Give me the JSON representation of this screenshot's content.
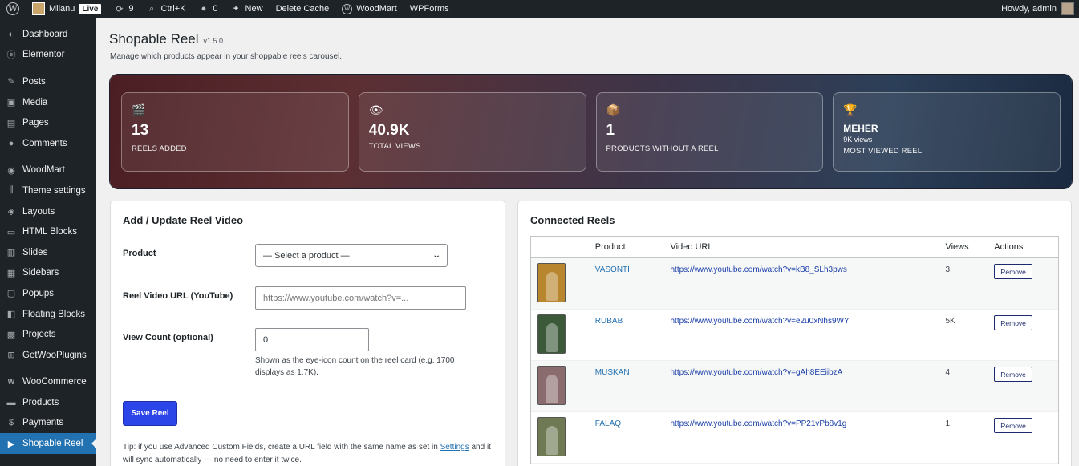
{
  "adminbar": {
    "site_name": "Milanu",
    "live_badge": "Live",
    "updates_count": "9",
    "shortcut": "Ctrl+K",
    "comments_count": "0",
    "new_label": "New",
    "delete_cache": "Delete Cache",
    "woodmart": "WoodMart",
    "wpforms": "WPForms",
    "howdy": "Howdy, admin"
  },
  "sidebar": {
    "items": [
      {
        "label": "Dashboard",
        "icon": "dashboard-icon"
      },
      {
        "label": "Elementor",
        "icon": "elementor-icon"
      },
      {
        "label": "Posts",
        "icon": "pin-icon"
      },
      {
        "label": "Media",
        "icon": "media-icon"
      },
      {
        "label": "Pages",
        "icon": "pages-icon"
      },
      {
        "label": "Comments",
        "icon": "comment-icon"
      },
      {
        "label": "WoodMart",
        "icon": "woodmart-icon"
      },
      {
        "label": "Theme settings",
        "icon": "sliders-icon"
      },
      {
        "label": "Layouts",
        "icon": "layers-icon"
      },
      {
        "label": "HTML Blocks",
        "icon": "html-icon"
      },
      {
        "label": "Slides",
        "icon": "slides-icon"
      },
      {
        "label": "Sidebars",
        "icon": "sidebar-icon"
      },
      {
        "label": "Popups",
        "icon": "popup-icon"
      },
      {
        "label": "Floating Blocks",
        "icon": "floating-icon"
      },
      {
        "label": "Projects",
        "icon": "projects-icon"
      },
      {
        "label": "GetWooPlugins",
        "icon": "plugin-icon"
      },
      {
        "label": "WooCommerce",
        "icon": "woo-icon"
      },
      {
        "label": "Products",
        "icon": "products-icon"
      },
      {
        "label": "Payments",
        "icon": "payments-icon"
      },
      {
        "label": "Shopable Reel",
        "icon": "play-icon"
      }
    ]
  },
  "page": {
    "title": "Shopable Reel",
    "version": "v1.5.0",
    "description": "Manage which products appear in your shoppable reels carousel."
  },
  "stats": [
    {
      "icon": "clapper-icon",
      "value": "13",
      "label": "REELS ADDED"
    },
    {
      "icon": "eye-icon",
      "value": "40.9K",
      "label": "TOTAL VIEWS"
    },
    {
      "icon": "box-icon",
      "value": "1",
      "label": "PRODUCTS WITHOUT A REEL"
    },
    {
      "icon": "trophy-icon",
      "value": "MEHER",
      "sub": "9K views",
      "label": "MOST VIEWED REEL"
    }
  ],
  "form": {
    "title": "Add / Update Reel Video",
    "product_label": "Product",
    "product_selected": "— Select a product —",
    "url_label": "Reel Video URL (YouTube)",
    "url_placeholder": "https://www.youtube.com/watch?v=...",
    "views_label": "View Count (optional)",
    "views_value": "0",
    "views_hint": "Shown as the eye-icon count on the reel card (e.g. 1700 displays as 1.7K).",
    "save_label": "Save Reel",
    "tip_before": "Tip: if you use Advanced Custom Fields, create a URL field with the same name as set in ",
    "tip_link": "Settings",
    "tip_after": " and it will sync automatically — no need to enter it twice."
  },
  "reels": {
    "title": "Connected Reels",
    "columns": {
      "product": "Product",
      "url": "Video URL",
      "views": "Views",
      "actions": "Actions"
    },
    "remove_label": "Remove",
    "rows": [
      {
        "product": "VASONTI",
        "url": "https://www.youtube.com/watch?v=kB8_SLh3pws",
        "views": "3",
        "thumb_color": "#b8862e"
      },
      {
        "product": "RUBAB",
        "url": "https://www.youtube.com/watch?v=e2u0xNhs9WY",
        "views": "5K",
        "thumb_color": "#3c5a3a"
      },
      {
        "product": "MUSKAN",
        "url": "https://www.youtube.com/watch?v=gAh8EEiibzA",
        "views": "4",
        "thumb_color": "#8a6b6e"
      },
      {
        "product": "FALAQ",
        "url": "https://www.youtube.com/watch?v=PP21vPb8v1g",
        "views": "1",
        "thumb_color": "#6f7a55"
      }
    ]
  }
}
